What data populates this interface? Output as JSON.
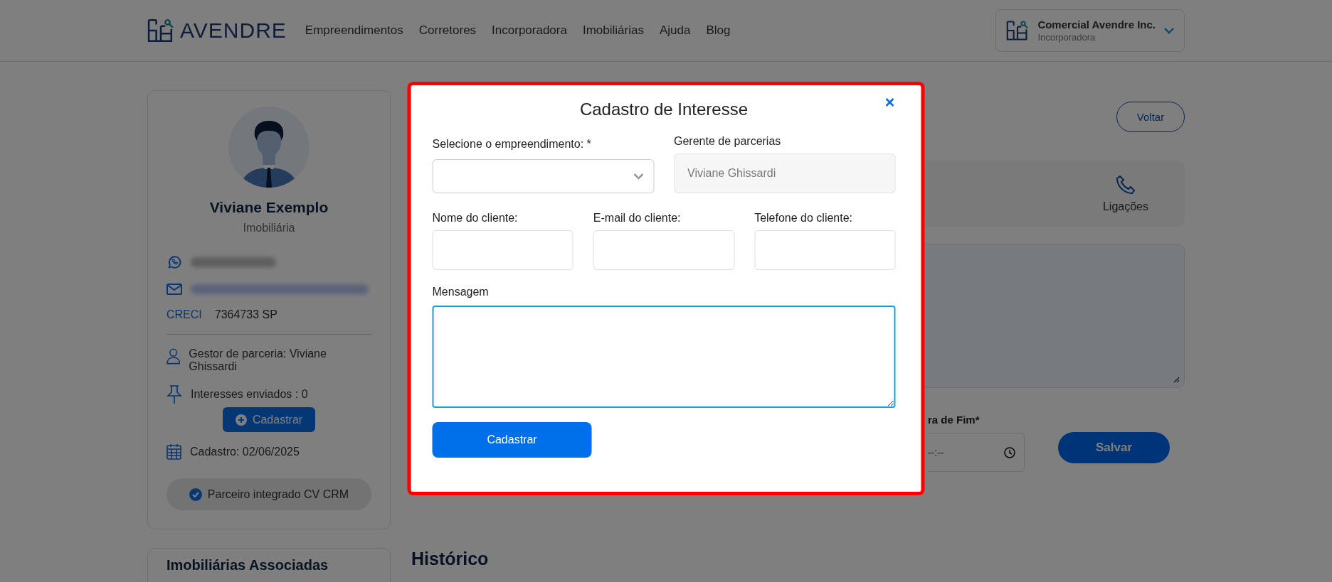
{
  "header": {
    "logo": "AVENDRE",
    "nav": [
      "Empreendimentos",
      "Corretores",
      "Incorporadora",
      "Imobiliárias",
      "Ajuda",
      "Blog"
    ],
    "account": {
      "name": "Comercial Avendre Inc.",
      "role": "Incorporadora"
    }
  },
  "profile": {
    "name": "Viviane Exemplo",
    "type": "Imobiliária",
    "creci_label": "CRECI",
    "creci": "7364733 SP",
    "manager": "Gestor de parceria: Viviane Ghissardi",
    "interests": "Interesses enviados : 0",
    "register_button": "Cadastrar",
    "registered": "Cadastro: 02/06/2025",
    "integration_badge": "Parceiro integrado CV CRM"
  },
  "associated": {
    "title": "Imobiliárias Associadas"
  },
  "main": {
    "back_button": "Voltar",
    "tab": "Ligações",
    "end_time_label": "ra de Fim*",
    "end_time_value": "–:–",
    "save_button": "Salvar",
    "history_title": "Histórico"
  },
  "modal": {
    "title": "Cadastro de Interesse",
    "development": {
      "label": "Selecione o empreendimento: *"
    },
    "manager": {
      "label": "Gerente de parcerias",
      "value": "Viviane Ghissardi",
      "disabled": true
    },
    "client_fields": [
      {
        "label": "Nome do cliente:"
      },
      {
        "label": "E-mail do cliente:"
      },
      {
        "label": "Telefone do cliente:"
      }
    ],
    "message": {
      "label": "Mensagem",
      "focused": true
    },
    "submit_button": "Cadastrar"
  }
}
